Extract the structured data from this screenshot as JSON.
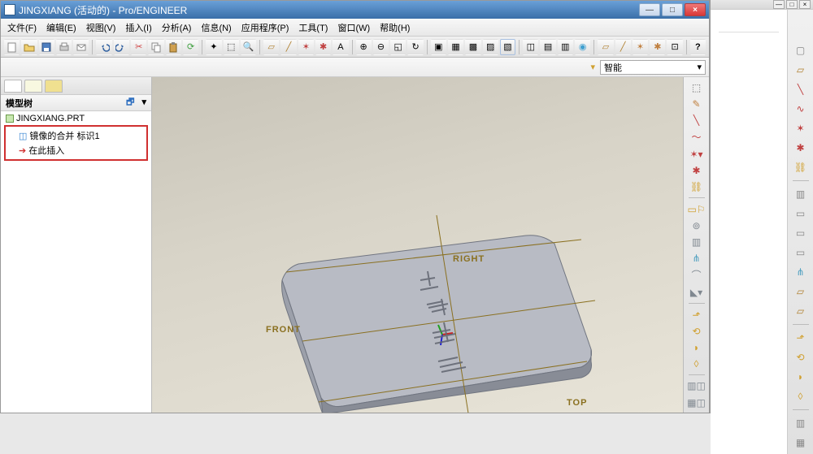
{
  "window": {
    "title": "JINGXIANG (活动的) - Pro/ENGINEER",
    "minimize": "—",
    "maximize": "□",
    "close": "×"
  },
  "menus": {
    "file": "文件(F)",
    "edit": "编辑(E)",
    "view": "视图(V)",
    "insert": "插入(I)",
    "analyze": "分析(A)",
    "info": "信息(N)",
    "apps": "应用程序(P)",
    "tools": "工具(T)",
    "window": "窗口(W)",
    "help": "帮助(H)"
  },
  "filter": {
    "label": "智能",
    "arrow": "▾"
  },
  "sidebar": {
    "header": "模型树",
    "root": "JINGXIANG.PRT",
    "item1": "镜像的合并 标识1",
    "item2": "在此插入",
    "tree_icon": "🔽",
    "menu_icon": "▾"
  },
  "labels3d": {
    "front": "FRONT",
    "right": "RIGHT",
    "top": "TOP"
  },
  "icons": {
    "dot": "•",
    "pencil": "✎",
    "curve": "～",
    "star": "✶",
    "chain": "⛓",
    "flag": "⚐",
    "axis": "╳",
    "shape1": "▭",
    "quest": "?",
    "tri": "▷",
    "circ": "○",
    "link": "⇗",
    "drop": "▾",
    "page": "▢",
    "fold": "▱",
    "wave": "∿",
    "box": "▥",
    "para": "▱",
    "cut": "✂"
  }
}
